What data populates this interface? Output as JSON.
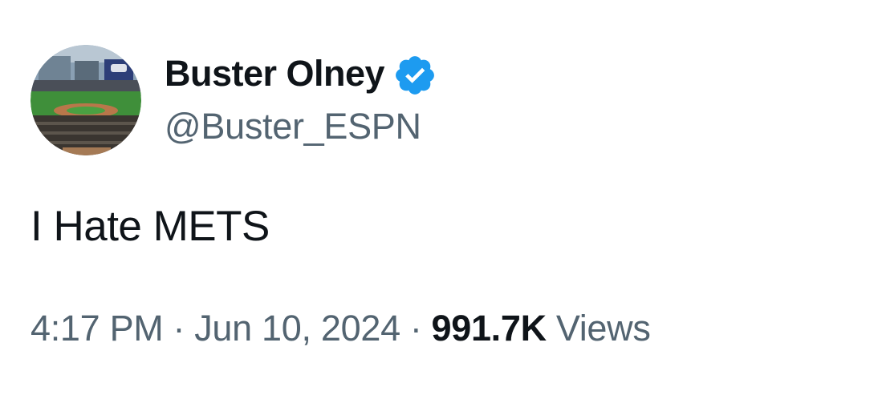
{
  "author": {
    "display_name": "Buster Olney",
    "handle": "@Buster_ESPN",
    "verified": true,
    "verified_color": "#1d9bf0",
    "avatar_icon": "baseball-stadium-avatar"
  },
  "tweet": {
    "text": "I Hate METS"
  },
  "meta": {
    "time": "4:17 PM",
    "separator": "·",
    "date": "Jun 10, 2024",
    "views_count": "991.7K",
    "views_label": "Views"
  },
  "colors": {
    "text_primary": "#0f1419",
    "text_secondary": "#536471",
    "background": "#ffffff"
  }
}
